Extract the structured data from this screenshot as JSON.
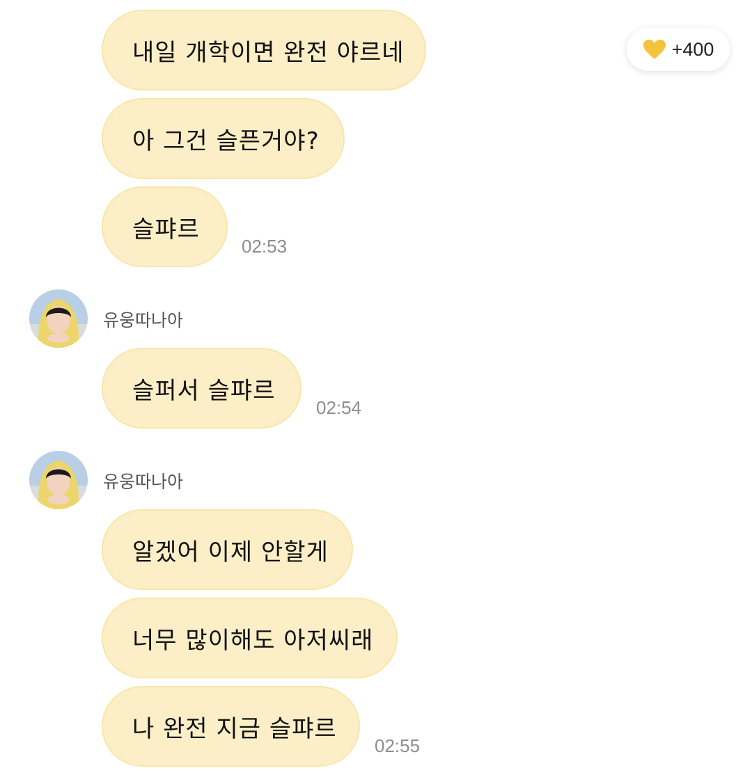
{
  "reward": {
    "icon": "heart-icon",
    "color": "#f5c33b",
    "label": "+400"
  },
  "messages": [
    {
      "text": "내일 개학이면 완전 야르네"
    },
    {
      "text": "아 그건 슬픈거야?"
    },
    {
      "text": "슬퍄르",
      "time": "02:53"
    },
    {
      "sender": "유웅따나아",
      "text": "슬퍼서 슬퍄르",
      "time": "02:54"
    },
    {
      "sender": "유웅따나아",
      "text": "알겠어 이제 안할게"
    },
    {
      "text": "너무 많이해도 아저씨래"
    },
    {
      "text": "나 완전 지금 슬퍄르",
      "time": "02:55"
    }
  ],
  "colors": {
    "bubble_fill": "#fcefc7",
    "bubble_border": "#f8e6a8",
    "timestamp": "#8d8d8d"
  }
}
